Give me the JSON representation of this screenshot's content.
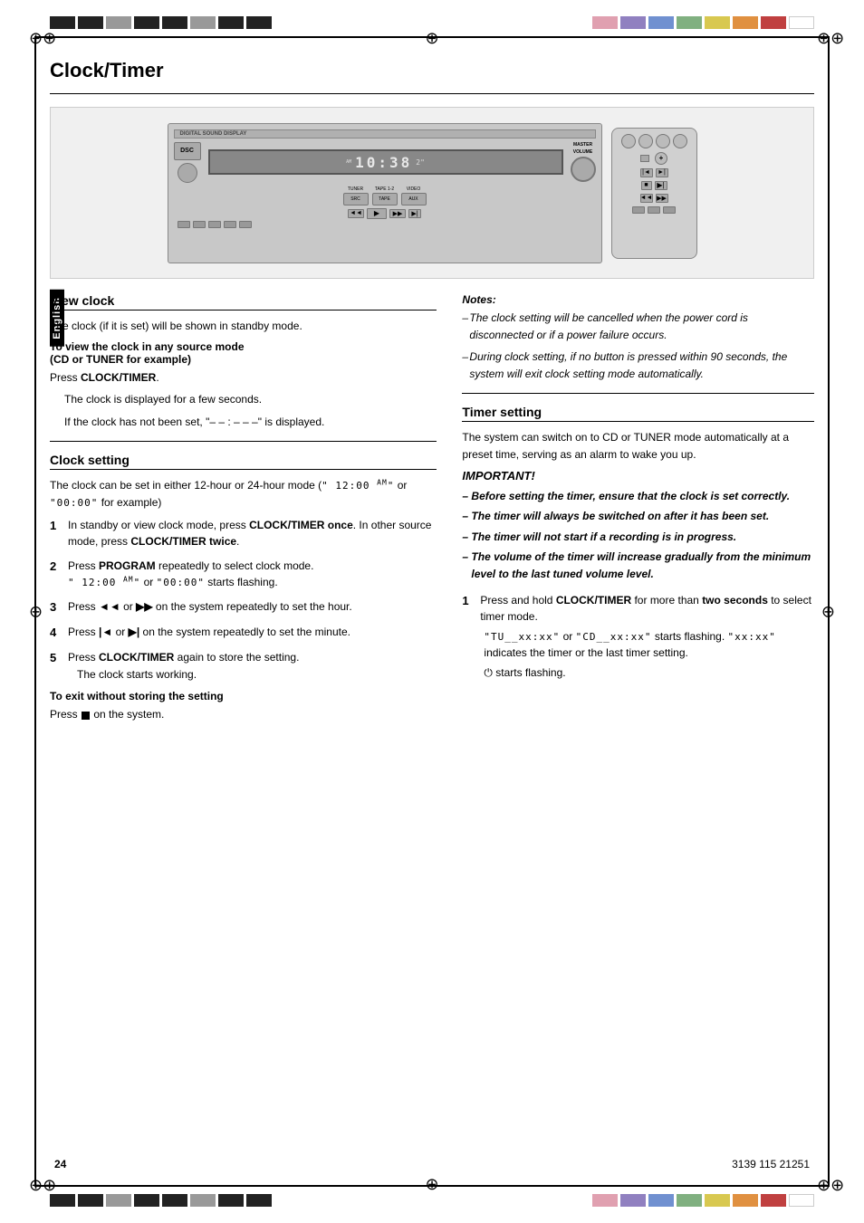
{
  "page": {
    "title": "Clock/Timer",
    "page_number": "24",
    "doc_number": "3139 115 21251",
    "sidebar_label": "English"
  },
  "top_strip": {
    "blocks_left": [
      "dark",
      "dark",
      "dark",
      "dark",
      "dark",
      "dark",
      "dark",
      "dark"
    ],
    "blocks_right": [
      "pink",
      "purple",
      "blue",
      "green",
      "yellow",
      "orange",
      "red",
      "white"
    ]
  },
  "view_clock": {
    "heading": "View clock",
    "intro": "The clock (if it is set) will be shown in standby mode.",
    "sub_heading": "To view the clock in any source mode (CD or TUNER for example)",
    "instruction": "Press CLOCK/TIMER.",
    "detail_1": "The clock is displayed for a few seconds.",
    "detail_2": "If the clock has not been set, \"– – : – – –\" is displayed."
  },
  "clock_setting": {
    "heading": "Clock setting",
    "intro": "The clock can be set in either 12-hour or 24-hour mode (\" 12:00  AM\" or \"00:00\" for example)",
    "steps": [
      {
        "num": "1",
        "text": "In standby or view clock mode, press CLOCK/TIMER once.  In other source mode, press CLOCK/TIMER twice."
      },
      {
        "num": "2",
        "text": "Press PROGRAM repeatedly to select clock mode.",
        "sub": "\" 12:00  AM\" or \"00:00\" starts flashing."
      },
      {
        "num": "3",
        "text": "Press ◄◄ or ►► on the system repeatedly to set the hour."
      },
      {
        "num": "4",
        "text": "Press |◄ or ►| on the system repeatedly to set the minute."
      },
      {
        "num": "5",
        "text": "Press CLOCK/TIMER again to store the setting.",
        "sub": "The clock starts working."
      }
    ],
    "exit_heading": "To exit without storing the setting",
    "exit_instruction": "Press ■ on the system."
  },
  "notes": {
    "label": "Notes:",
    "items": [
      "The clock setting will be cancelled when the power cord is disconnected or if a power failure occurs.",
      "During clock setting, if no button is pressed within 90 seconds, the system will exit clock setting mode automatically."
    ]
  },
  "timer_setting": {
    "heading": "Timer setting",
    "intro": "The system can switch on to CD or TUNER mode automatically at a preset time, serving as an alarm to wake you up.",
    "important_label": "IMPORTANT!",
    "important_items": [
      "Before setting the timer, ensure that the clock is set correctly.",
      "The timer will always be switched on after it has been set.",
      "The timer will not start if a recording is in progress.",
      "The volume of the timer will increase gradually from the minimum level to the last tuned volume level."
    ],
    "steps": [
      {
        "num": "1",
        "text": "Press and hold CLOCK/TIMER for more than two seconds to select timer mode.",
        "sub_1": "\"TU__xx:xx\" or \"CD__xx:xx\" starts flashing. \"xx:xx\" indicates the timer or the last timer setting.",
        "sub_2": "⏻ starts flashing."
      }
    ]
  },
  "view_clock_source_mode_text": "view clock source mode",
  "exit_without_storing_text": "exit without storing the setting"
}
